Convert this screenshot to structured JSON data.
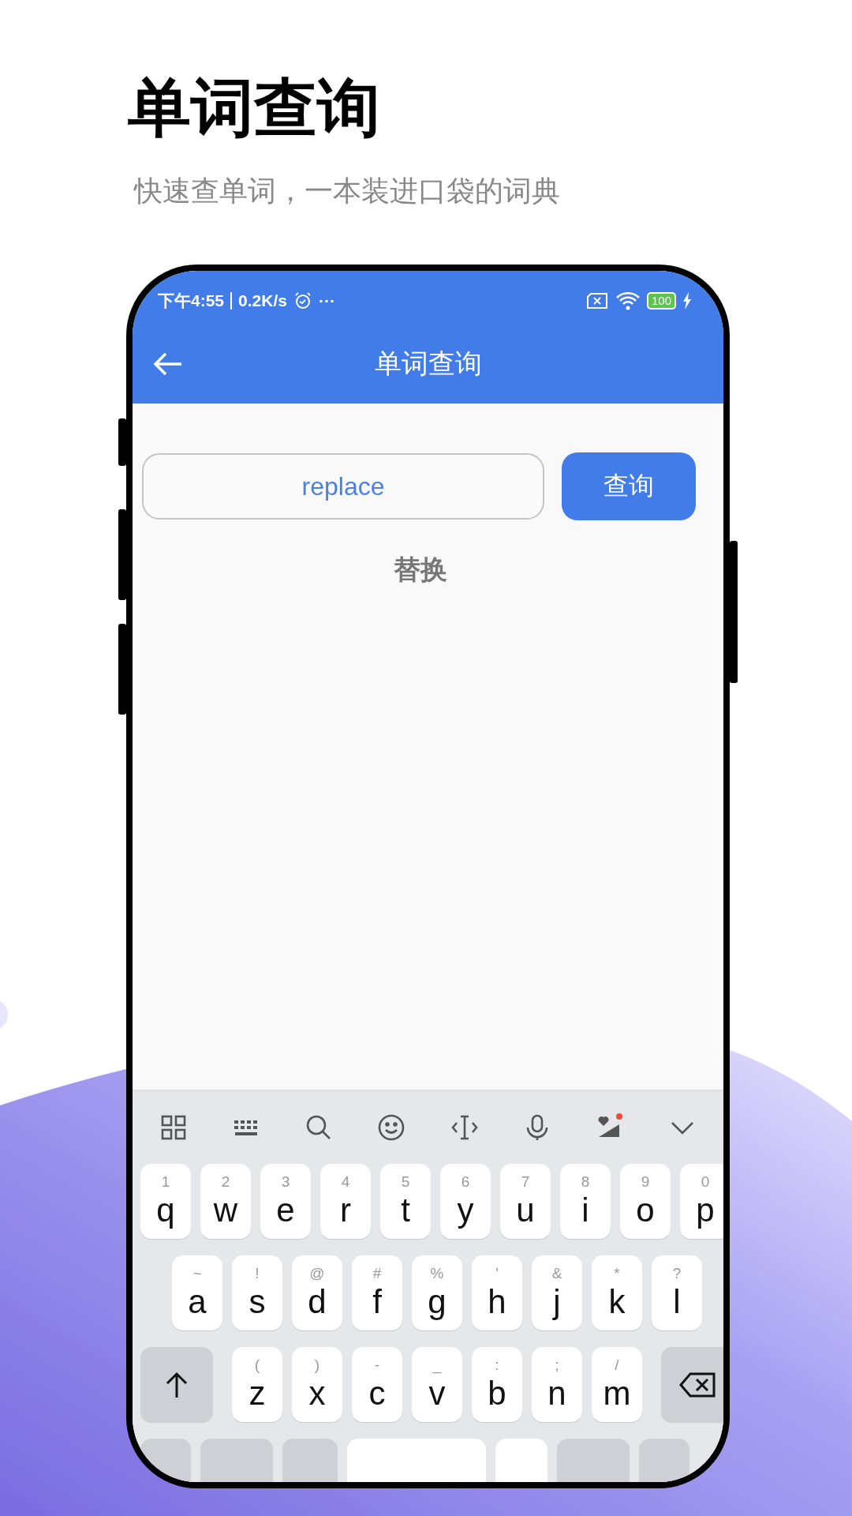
{
  "heading": {
    "title": "单词查询",
    "subtitle": "快速查单词，一本装进口袋的词典"
  },
  "status_bar": {
    "time": "下午4:55",
    "speed": "0.2K/s",
    "more": "···",
    "battery": "100"
  },
  "app_bar": {
    "title": "单词查询"
  },
  "search": {
    "value": "replace",
    "button": "查询"
  },
  "result": "替换",
  "keyboard": {
    "rows": [
      [
        {
          "kind": "letter",
          "hint": "1",
          "label": "q"
        },
        {
          "kind": "letter",
          "hint": "2",
          "label": "w"
        },
        {
          "kind": "letter",
          "hint": "3",
          "label": "e"
        },
        {
          "kind": "letter",
          "hint": "4",
          "label": "r"
        },
        {
          "kind": "letter",
          "hint": "5",
          "label": "t"
        },
        {
          "kind": "letter",
          "hint": "6",
          "label": "y"
        },
        {
          "kind": "letter",
          "hint": "7",
          "label": "u"
        },
        {
          "kind": "letter",
          "hint": "8",
          "label": "i"
        },
        {
          "kind": "letter",
          "hint": "9",
          "label": "o"
        },
        {
          "kind": "letter",
          "hint": "0",
          "label": "p"
        }
      ],
      [
        {
          "kind": "letter",
          "hint": "~",
          "label": "a"
        },
        {
          "kind": "letter",
          "hint": "!",
          "label": "s"
        },
        {
          "kind": "letter",
          "hint": "@",
          "label": "d"
        },
        {
          "kind": "letter",
          "hint": "#",
          "label": "f"
        },
        {
          "kind": "letter",
          "hint": "%",
          "label": "g"
        },
        {
          "kind": "letter",
          "hint": "'",
          "label": "h"
        },
        {
          "kind": "letter",
          "hint": "&",
          "label": "j"
        },
        {
          "kind": "letter",
          "hint": "*",
          "label": "k"
        },
        {
          "kind": "letter",
          "hint": "?",
          "label": "l"
        }
      ],
      [
        {
          "kind": "shift"
        },
        {
          "kind": "letter",
          "hint": "(",
          "label": "z"
        },
        {
          "kind": "letter",
          "hint": ")",
          "label": "x"
        },
        {
          "kind": "letter",
          "hint": "-",
          "label": "c"
        },
        {
          "kind": "letter",
          "hint": "_",
          "label": "v"
        },
        {
          "kind": "letter",
          "hint": ":",
          "label": "b"
        },
        {
          "kind": "letter",
          "hint": ";",
          "label": "n"
        },
        {
          "kind": "letter",
          "hint": "/",
          "label": "m"
        },
        {
          "kind": "delete"
        }
      ],
      [
        {
          "kind": "function"
        },
        {
          "kind": "function"
        },
        {
          "kind": "caps"
        },
        {
          "kind": "space"
        },
        {
          "kind": "punct"
        },
        {
          "kind": "function"
        },
        {
          "kind": "function"
        }
      ]
    ]
  }
}
